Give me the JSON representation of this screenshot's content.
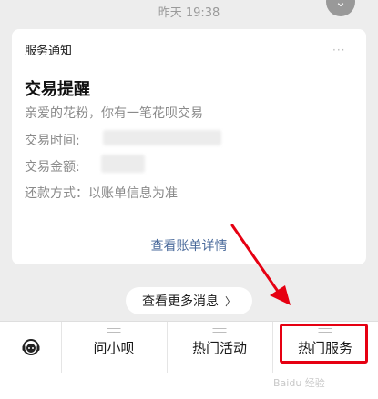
{
  "chat": {
    "timestamp": "昨天 19:38"
  },
  "card": {
    "header": "服务通知",
    "more": "···",
    "title": "交易提醒",
    "greeting": "亲爱的花粉，你有一笔花呗交易",
    "time_label": "交易时间:",
    "amount_label": "交易金额:",
    "repay_line": "还款方式：以账单信息为准",
    "detail_link": "查看账单详情"
  },
  "more_messages": {
    "label": "查看更多消息",
    "chevron": "〉"
  },
  "tabbar": {
    "items": [
      {
        "icon": "customer-service-icon"
      },
      {
        "label": "问小呗"
      },
      {
        "label": "热门活动"
      },
      {
        "label": "热门服务"
      }
    ]
  },
  "annotation": {
    "highlight_color": "#e60012"
  },
  "watermark": {
    "text": "Baidu 经验"
  }
}
